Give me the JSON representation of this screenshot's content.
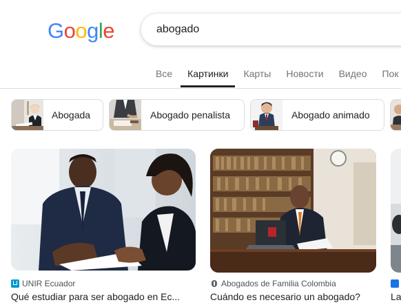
{
  "logo": {
    "letters": [
      "G",
      "o",
      "o",
      "g",
      "l",
      "e"
    ],
    "colors": [
      "#4285F4",
      "#EA4335",
      "#FBBC05",
      "#4285F4",
      "#34A853",
      "#EA4335"
    ]
  },
  "search": {
    "query": "abogado"
  },
  "tabs": [
    {
      "label": "Все"
    },
    {
      "label": "Картинки",
      "active": true
    },
    {
      "label": "Карты"
    },
    {
      "label": "Новости"
    },
    {
      "label": "Видео"
    },
    {
      "label": "Пок"
    }
  ],
  "chips": [
    {
      "label": "Abogada"
    },
    {
      "label": "Abogado penalista"
    },
    {
      "label": "Abogado animado"
    }
  ],
  "results": [
    {
      "source": "UNIR Ecuador",
      "title": "Qué estudiar para ser abogado en Ec..."
    },
    {
      "source": "Abogados de Familia Colombia",
      "title": "Cuándo es necesario un abogado?"
    },
    {
      "source": "",
      "title": "La"
    }
  ],
  "colors": {
    "text_primary": "#202124",
    "text_secondary": "#70757a",
    "border": "#dadce0",
    "unir_blue": "#0098cd"
  }
}
